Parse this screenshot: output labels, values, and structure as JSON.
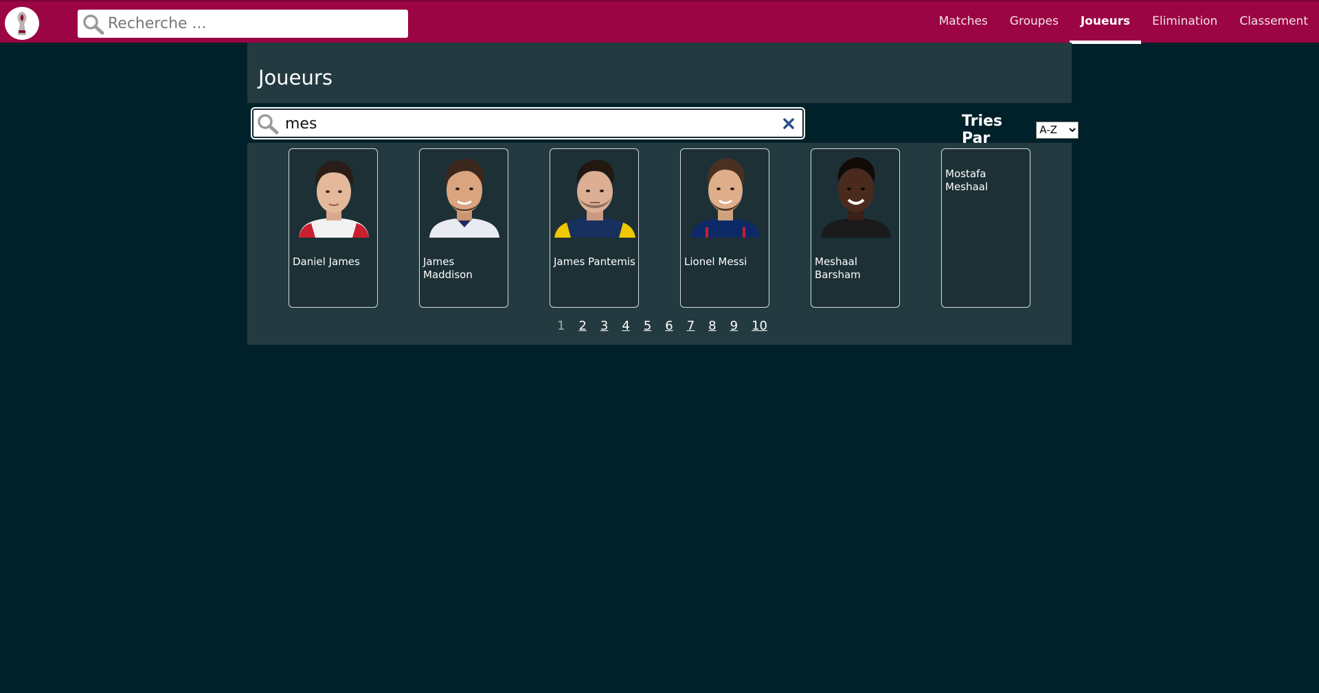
{
  "header": {
    "logo_icon": "world-cup-trophy-icon",
    "search_placeholder": "Recherche ...",
    "nav": [
      {
        "label": "Matches",
        "active": false
      },
      {
        "label": "Groupes",
        "active": false
      },
      {
        "label": "Joueurs",
        "active": true
      },
      {
        "label": "Elimination",
        "active": false
      },
      {
        "label": "Classement",
        "active": false
      }
    ]
  },
  "main": {
    "title": "Joueurs",
    "search": {
      "value": "mes",
      "icon": "search-icon",
      "clear_icon": "close-icon"
    },
    "sort": {
      "label": "Tries Par",
      "selected": "A-Z"
    },
    "players": [
      {
        "name": "Daniel James",
        "has_photo": true,
        "jersey": "#c8202f"
      },
      {
        "name": "James Maddison",
        "has_photo": true,
        "jersey": "#e8ecf2"
      },
      {
        "name": "James Pantemis",
        "has_photo": true,
        "jersey": "#f0c800"
      },
      {
        "name": "Lionel Messi",
        "has_photo": true,
        "jersey": "#0d2a66"
      },
      {
        "name": "Meshaal Barsham",
        "has_photo": true,
        "jersey": "#1a1a1a"
      },
      {
        "name": "Mostafa Meshaal",
        "has_photo": false,
        "jersey": ""
      }
    ],
    "pagination": {
      "current": "1",
      "pages": [
        "1",
        "2",
        "3",
        "4",
        "5",
        "6",
        "7",
        "8",
        "9",
        "10"
      ]
    }
  },
  "colors": {
    "topbar": "#9b0543",
    "background": "#01212a",
    "panel": "#233a40"
  }
}
